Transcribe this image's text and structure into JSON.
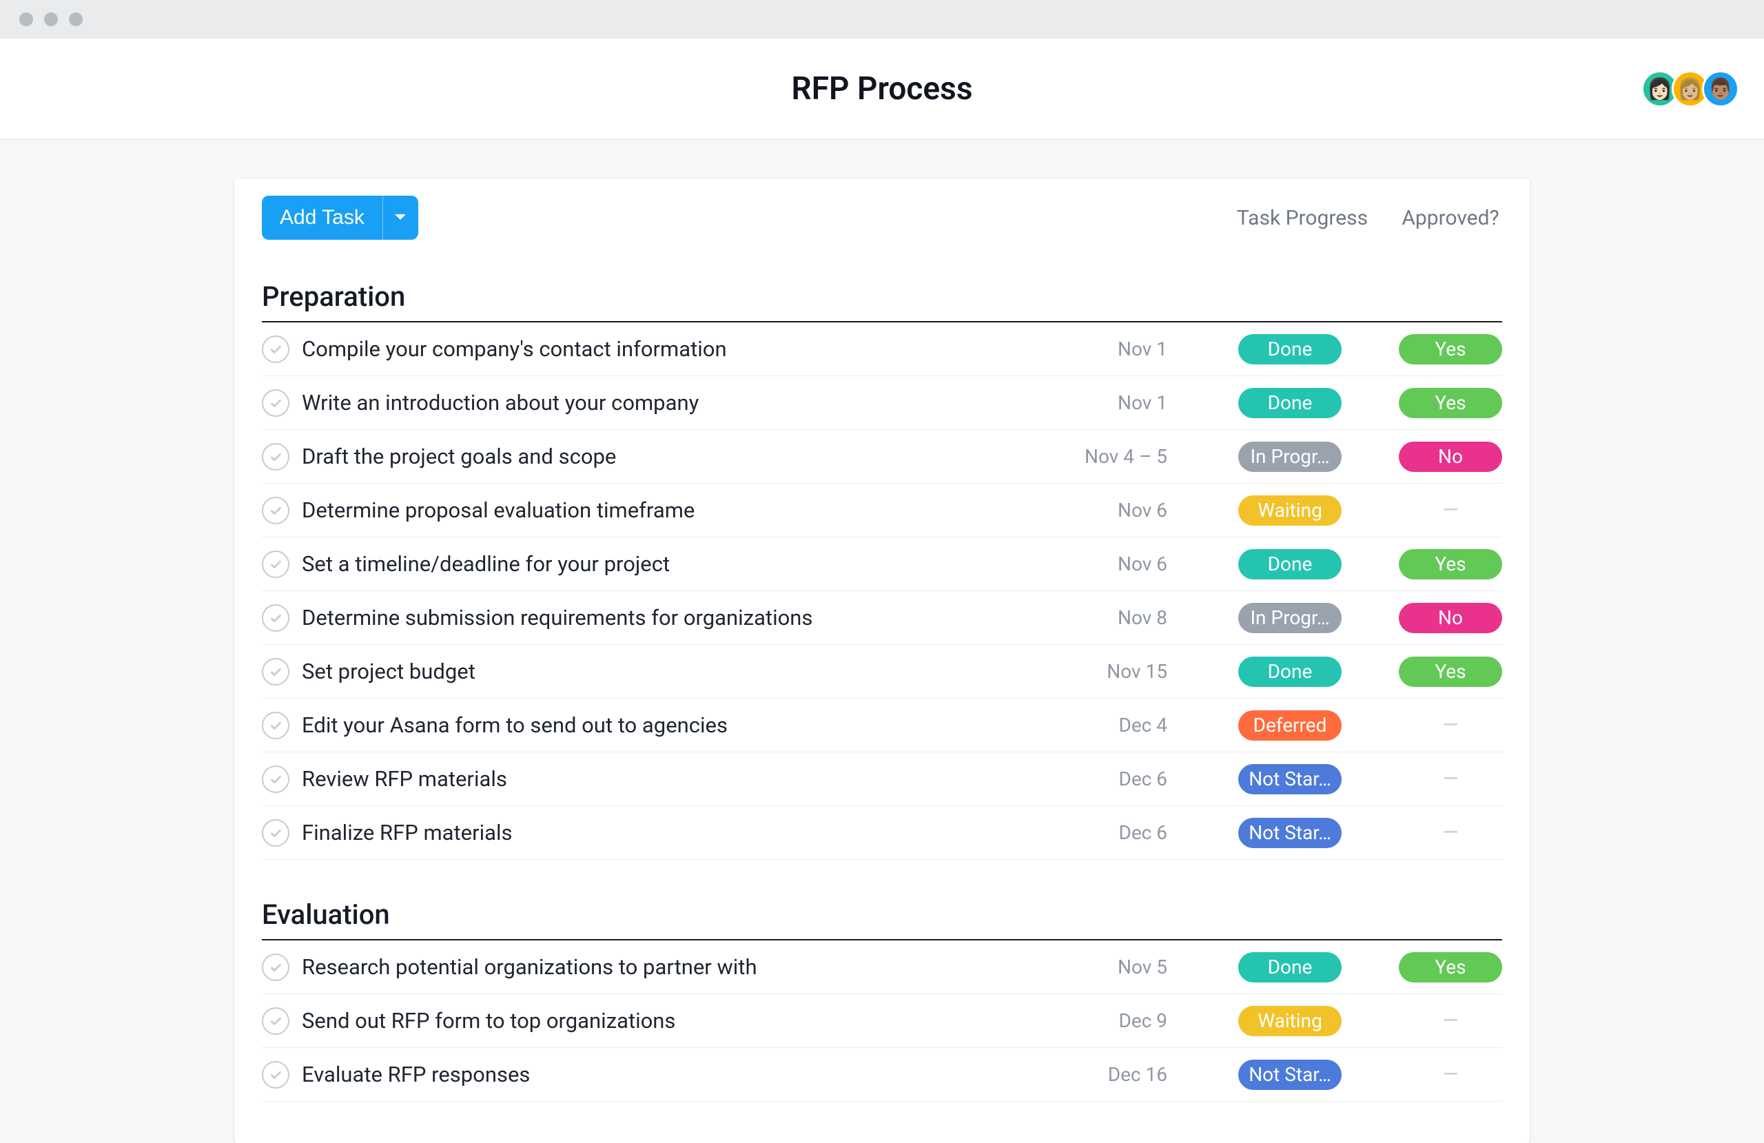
{
  "header": {
    "title": "RFP Process"
  },
  "toolbar": {
    "add_task_label": "Add Task"
  },
  "columns": {
    "progress": "Task Progress",
    "approved": "Approved?"
  },
  "pill_colors": {
    "Done": "#25c4b0",
    "In Progr…": "#9aa2ae",
    "Waiting": "#f2c229",
    "Deferred": "#ff6b3d",
    "Not Star…": "#4d7bdb",
    "Yes": "#62c956",
    "No": "#e8328c"
  },
  "avatars": [
    {
      "bg": "#25c2a0",
      "emoji": "👩🏻"
    },
    {
      "bg": "#ffb300",
      "emoji": "👩🏼"
    },
    {
      "bg": "#19a0f4",
      "emoji": "👨🏽"
    }
  ],
  "sections": [
    {
      "title": "Preparation",
      "tasks": [
        {
          "title": "Compile your company's contact information",
          "date": "Nov 1",
          "progress": "Done",
          "approved": "Yes"
        },
        {
          "title": "Write an introduction about your company",
          "date": "Nov 1",
          "progress": "Done",
          "approved": "Yes"
        },
        {
          "title": "Draft the project goals and scope",
          "date": "Nov 4 – 5",
          "progress": "In Progr…",
          "approved": "No"
        },
        {
          "title": "Determine proposal evaluation timeframe",
          "date": "Nov 6",
          "progress": "Waiting",
          "approved": null
        },
        {
          "title": "Set a timeline/deadline for your project",
          "date": "Nov 6",
          "progress": "Done",
          "approved": "Yes"
        },
        {
          "title": "Determine submission requirements for organizations",
          "date": "Nov 8",
          "progress": "In Progr…",
          "approved": "No"
        },
        {
          "title": "Set project budget",
          "date": "Nov 15",
          "progress": "Done",
          "approved": "Yes"
        },
        {
          "title": "Edit your Asana form to send out to agencies",
          "date": "Dec 4",
          "progress": "Deferred",
          "approved": null
        },
        {
          "title": "Review RFP materials",
          "date": "Dec 6",
          "progress": "Not Star…",
          "approved": null
        },
        {
          "title": "Finalize RFP materials",
          "date": "Dec 6",
          "progress": "Not Star…",
          "approved": null
        }
      ]
    },
    {
      "title": "Evaluation",
      "tasks": [
        {
          "title": "Research potential organizations to partner with",
          "date": "Nov 5",
          "progress": "Done",
          "approved": "Yes"
        },
        {
          "title": "Send out RFP form to top organizations",
          "date": "Dec 9",
          "progress": "Waiting",
          "approved": null
        },
        {
          "title": "Evaluate RFP responses",
          "date": "Dec 16",
          "progress": "Not Star…",
          "approved": null
        }
      ]
    }
  ]
}
